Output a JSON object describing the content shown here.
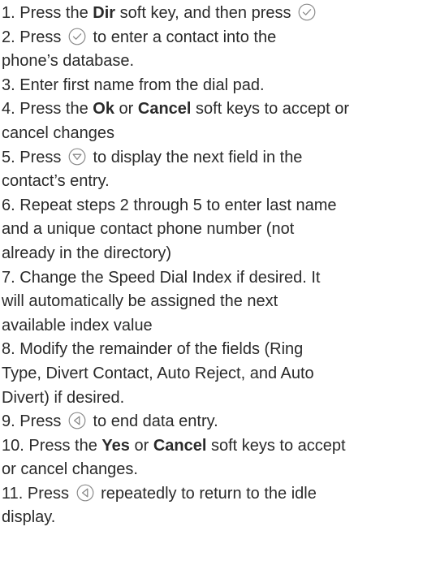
{
  "steps": [
    {
      "num": "1.",
      "lines": [
        [
          "Press the ",
          {
            "b": "Dir"
          },
          " soft key, and then press ",
          {
            "icon": "check-circle-icon"
          }
        ]
      ]
    },
    {
      "num": "2.",
      "lines": [
        [
          "Press ",
          {
            "icon": "check-circle-icon"
          },
          " to enter a contact into the"
        ],
        [
          "phone’s database."
        ]
      ]
    },
    {
      "num": "3.",
      "lines": [
        [
          "Enter first name from the dial pad."
        ]
      ]
    },
    {
      "num": "4.",
      "lines": [
        [
          "Press the ",
          {
            "b": "Ok"
          },
          " or ",
          {
            "b": "Cancel"
          },
          " soft keys to accept or"
        ],
        [
          "cancel changes"
        ]
      ]
    },
    {
      "num": "5.",
      "lines": [
        [
          "Press ",
          {
            "icon": "down-arrow-circle-icon"
          },
          " to display the next field in the"
        ],
        [
          "contact’s entry."
        ]
      ]
    },
    {
      "num": "6.",
      "lines": [
        [
          "Repeat steps 2 through 5 to enter last name"
        ],
        [
          "and a unique contact phone number (not"
        ],
        [
          "already in the directory)"
        ]
      ]
    },
    {
      "num": "7.",
      "lines": [
        [
          "Change the Speed Dial Index if desired. It"
        ],
        [
          "will automatically be assigned the next"
        ],
        [
          "available index value"
        ]
      ]
    },
    {
      "num": "8.",
      "lines": [
        [
          "Modify the remainder of the fields (Ring"
        ],
        [
          "Type, Divert Contact, Auto Reject, and Auto"
        ],
        [
          "Divert) if desired."
        ]
      ]
    },
    {
      "num": "9.",
      "lines": [
        [
          "Press ",
          {
            "icon": "left-arrow-circle-icon"
          },
          " to end data entry."
        ]
      ]
    },
    {
      "num": "10.",
      "lines": [
        [
          "Press the ",
          {
            "b": "Yes"
          },
          " or ",
          {
            "b": "Cancel"
          },
          " soft keys to accept"
        ],
        [
          "or cancel changes."
        ]
      ]
    },
    {
      "num": "11.",
      "lines": [
        [
          "Press ",
          {
            "icon": "left-arrow-circle-icon"
          },
          " repeatedly to return to the idle"
        ],
        [
          "display."
        ]
      ]
    }
  ]
}
